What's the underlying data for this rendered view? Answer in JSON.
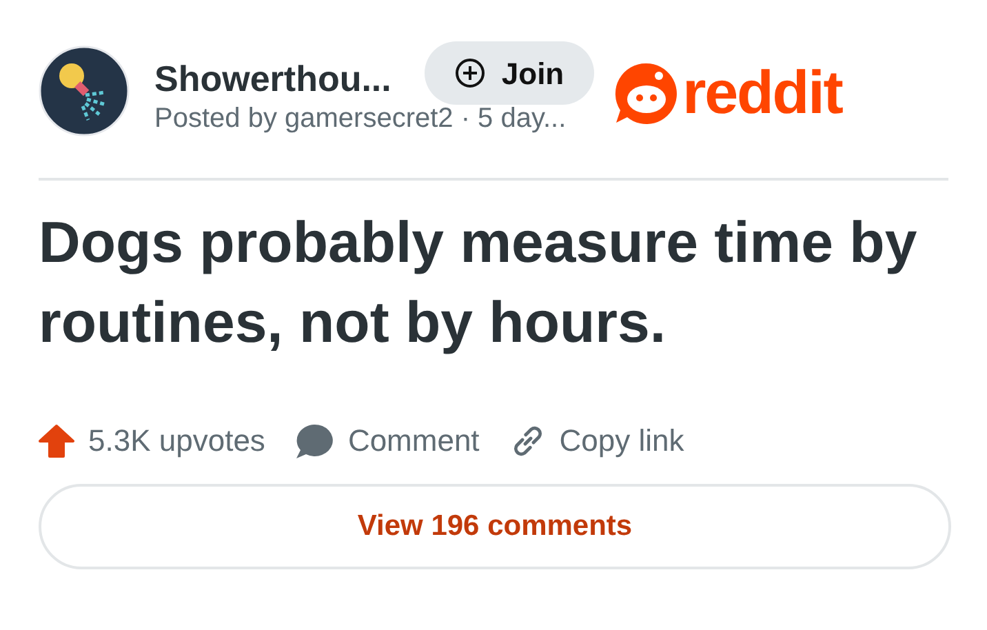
{
  "community": {
    "name": "Showerthou...",
    "byline": "Posted by gamersecret2 · 5 day..."
  },
  "join_button": {
    "label": "Join"
  },
  "logo": {
    "wordmark": "reddit"
  },
  "post": {
    "title": "Dogs probably measure time by routines, not by hours."
  },
  "actions": [
    {
      "kind": "upvote",
      "label": "5.3K upvotes"
    },
    {
      "kind": "comment",
      "label": "Comment"
    },
    {
      "kind": "link",
      "label": "Copy link"
    }
  ],
  "comments_button": {
    "label": "View 196 comments"
  }
}
